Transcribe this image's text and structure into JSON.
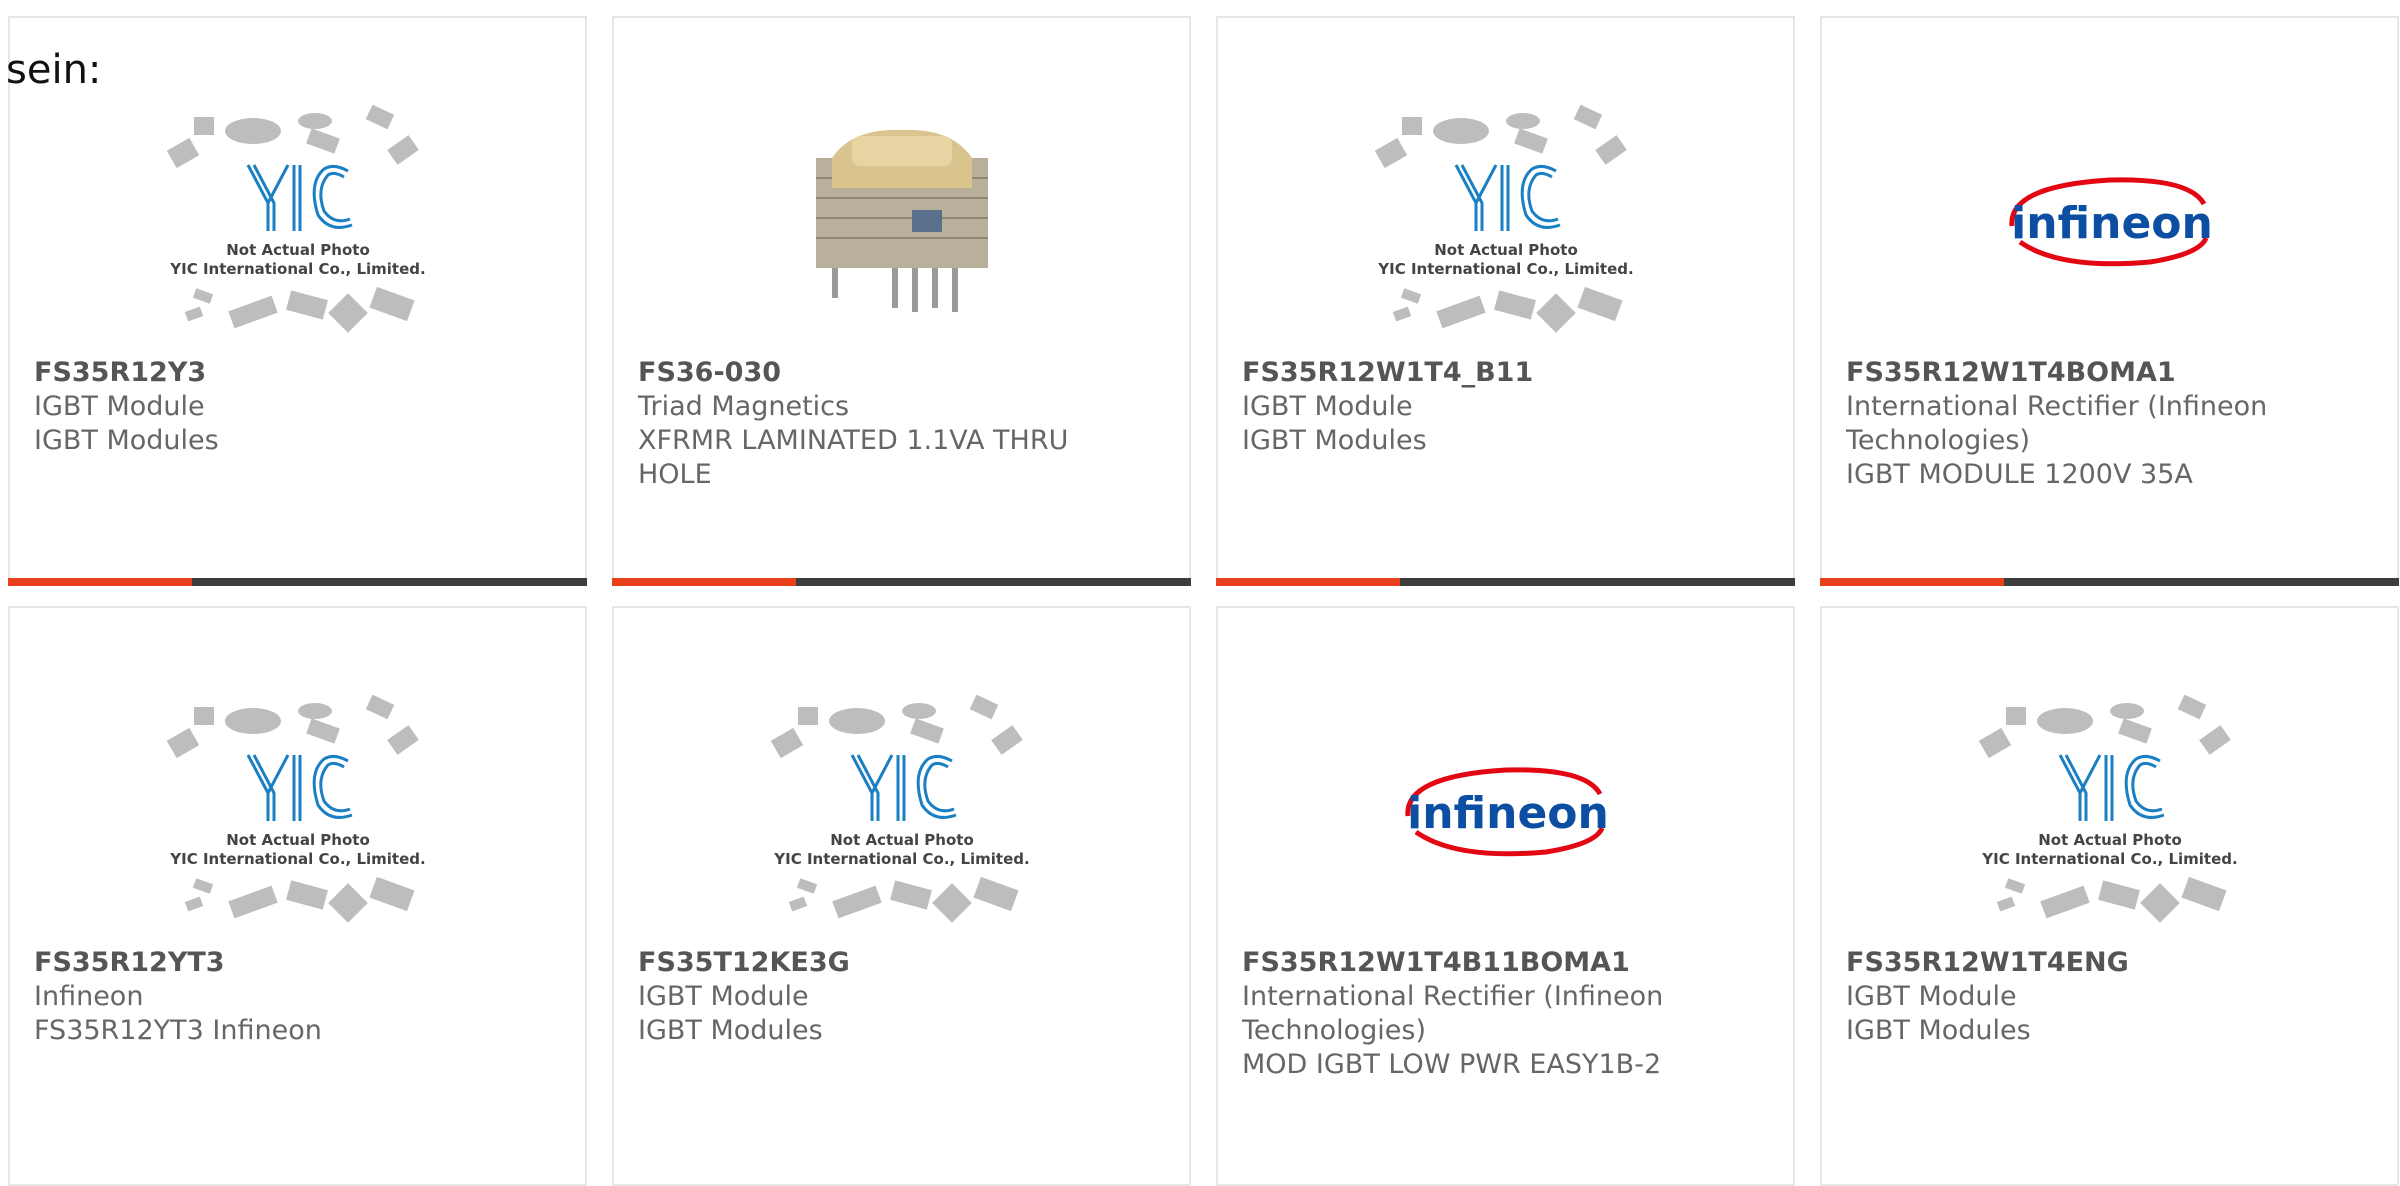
{
  "intro": {
    "text": "sein:"
  },
  "colors": {
    "accent": "#e8401c",
    "bar": "#3d3d3d",
    "yic_blue": "#1b7fc4",
    "infineon_blue": "#0b4ea2",
    "infineon_red": "#e30613"
  },
  "placeholder": {
    "line1": "Not Actual Photo",
    "line2": "YIC International Co., Limited.",
    "logo": "YIC"
  },
  "infineon_logo": {
    "text": "infineon"
  },
  "cards": [
    {
      "part_number": "FS35R12Y3",
      "image": "yic-placeholder-icon",
      "lines": [
        "IGBT Module",
        "IGBT Modules"
      ]
    },
    {
      "part_number": "FS36-030",
      "image": "transformer-photo-icon",
      "lines": [
        "Triad Magnetics",
        "XFRMR LAMINATED 1.1VA THRU",
        "HOLE"
      ]
    },
    {
      "part_number": "FS35R12W1T4_B11",
      "image": "yic-placeholder-icon",
      "lines": [
        "IGBT Module",
        "IGBT Modules"
      ]
    },
    {
      "part_number": "FS35R12W1T4BOMA1",
      "image": "infineon-logo-icon",
      "lines": [
        "International Rectifier (Infineon",
        "Technologies)",
        "IGBT MODULE 1200V 35A"
      ]
    },
    {
      "part_number": "FS35R12YT3",
      "image": "yic-placeholder-icon",
      "lines": [
        "Infineon",
        "FS35R12YT3 Infineon"
      ]
    },
    {
      "part_number": "FS35T12KE3G",
      "image": "yic-placeholder-icon",
      "lines": [
        "IGBT Module",
        "IGBT Modules"
      ]
    },
    {
      "part_number": "FS35R12W1T4B11BOMA1",
      "image": "infineon-logo-icon",
      "lines": [
        "International Rectifier (Infineon",
        "Technologies)",
        "MOD IGBT LOW PWR EASY1B-2"
      ]
    },
    {
      "part_number": "FS35R12W1T4ENG",
      "image": "yic-placeholder-icon",
      "lines": [
        "IGBT Module",
        "IGBT Modules"
      ]
    }
  ]
}
